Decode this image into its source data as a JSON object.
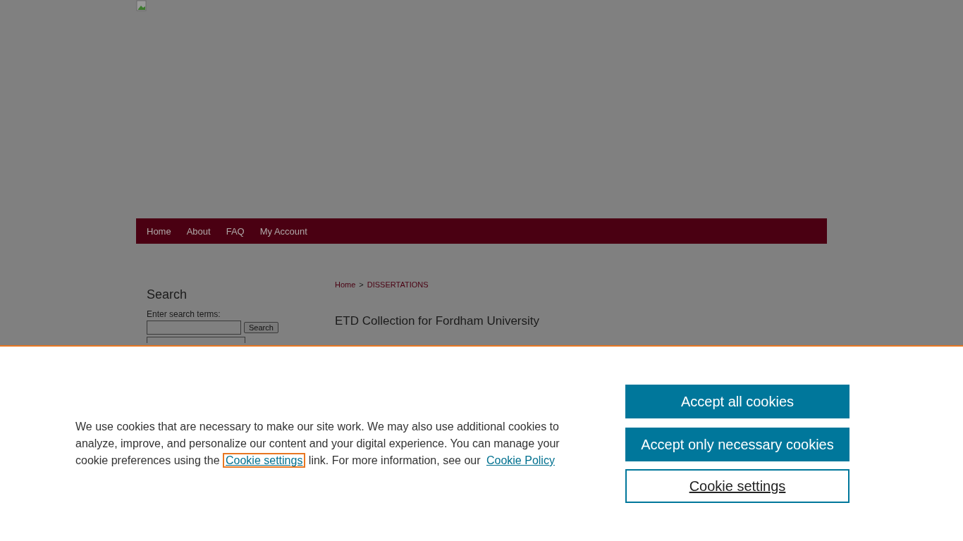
{
  "nav": [
    {
      "label": "Home"
    },
    {
      "label": "About"
    },
    {
      "label": "FAQ"
    },
    {
      "label": "My Account"
    }
  ],
  "breadcrumb": {
    "home": "Home",
    "separator": ">",
    "current": "DISSERTATIONS"
  },
  "search": {
    "title": "Search",
    "prompt": "Enter search terms:",
    "button": "Search"
  },
  "page_title": "ETD Collection for Fordham University",
  "cookie_banner": {
    "text_before": "We use cookies that are necessary to make our site work. We may also use additional cookies to analyze, improve, and personalize our content and your digital experience. You can manage your cookie preferences using the ",
    "settings_link": "Cookie settings",
    "text_middle": " link. For more information, see our ",
    "policy_link": "Cookie Policy",
    "buttons": [
      {
        "label": "Accept all cookies",
        "kind": "primary"
      },
      {
        "label": "Accept only necessary cookies",
        "kind": "primary"
      },
      {
        "label": "Cookie settings",
        "kind": "outline"
      }
    ]
  }
}
